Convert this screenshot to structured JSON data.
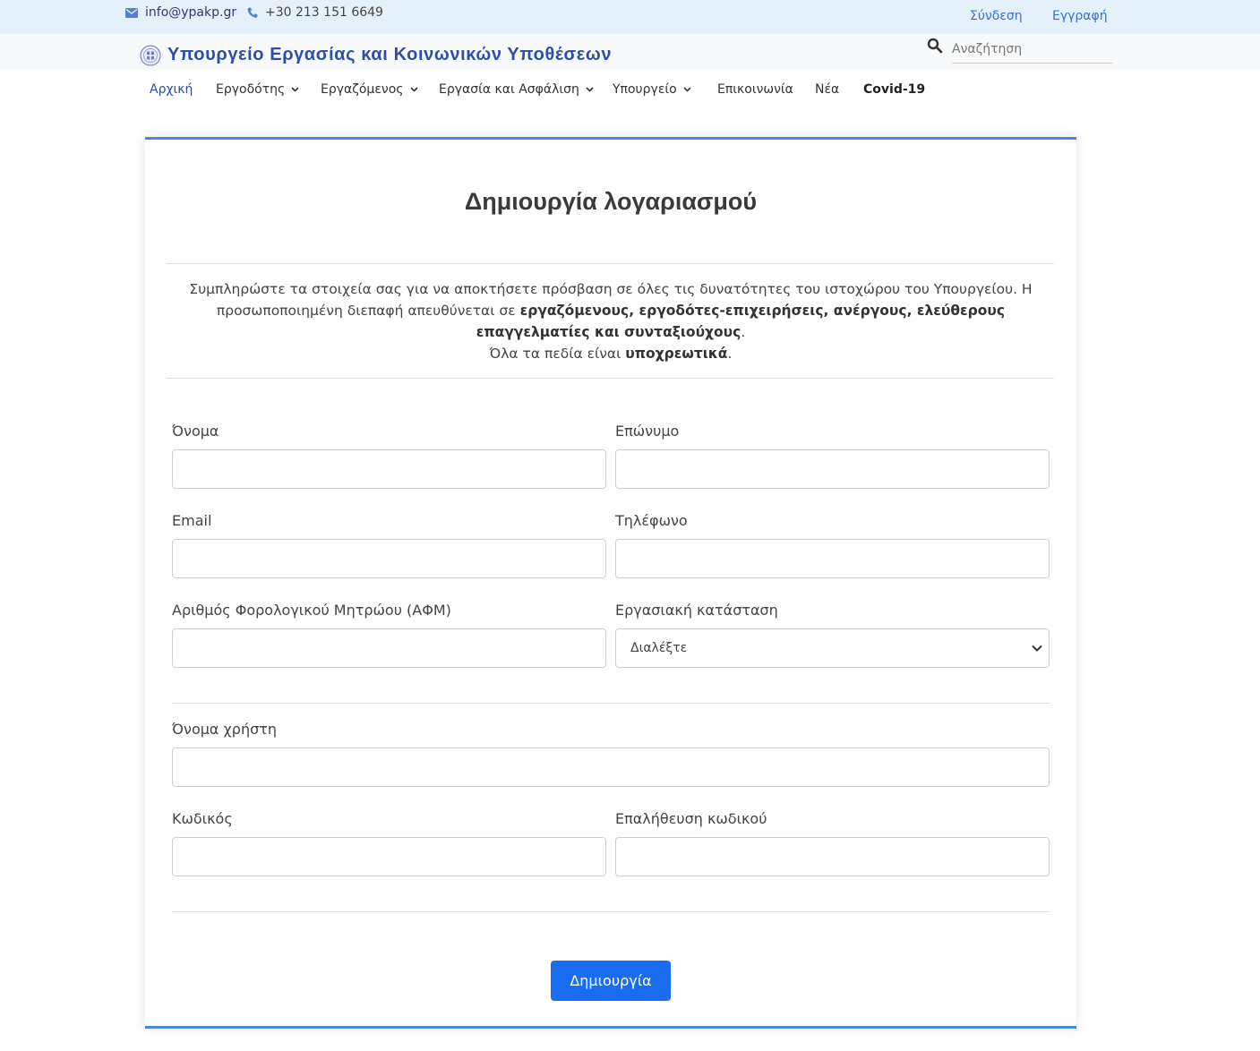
{
  "topbar": {
    "email": "info@ypakp.gr",
    "phone": "+30 213 151 6649",
    "login": "Σύνδεση",
    "register": "Εγγραφή"
  },
  "header": {
    "title": "Υπουργείο Εργασίας και Κοινωνικών Υποθέσεων",
    "search_placeholder": "Αναζήτηση"
  },
  "nav": {
    "items": [
      {
        "label": "Αρχική"
      },
      {
        "label": "Εργοδότης"
      },
      {
        "label": "Εργαζόμενος"
      },
      {
        "label": "Εργασία και Ασφάλιση"
      },
      {
        "label": "Υπουργείο"
      },
      {
        "label": "Επικοινωνία"
      },
      {
        "label": "Νέα"
      },
      {
        "label": "Covid-19"
      }
    ]
  },
  "form": {
    "title": "Δημιουργία λογαριασμού",
    "intro": {
      "p1": "Συμπληρώστε τα στοιχεία σας για να αποκτήσετε πρόσβαση σε όλες τις δυνατότητες του ιστοχώρου του Υπουργείου. Η προσωποποιημένη διεπαφή απευθύνεται σε ",
      "p1_bold": "εργαζόμενους, εργοδότες-επιχειρήσεις, ανέργους, ελεύθερους επαγγελματίες και συνταξιούχους",
      "p1_end": ".",
      "p2": "Όλα τα πεδία είναι ",
      "p2_bold": "υποχρεωτικά",
      "p2_end": "."
    },
    "labels": {
      "first_name": "Όνομα",
      "last_name": "Επώνυμο",
      "email": "Email",
      "phone": "Τηλέφωνο",
      "afm": "Αριθμός Φορολογικού Μητρώου (ΑΦΜ)",
      "employment_status": "Εργασιακή κατάσταση",
      "username": "Όνομα χρήστη",
      "password": "Κωδικός",
      "password_confirm": "Επαλήθευση κωδικού"
    },
    "values": {
      "first_name": "",
      "last_name": "",
      "email": "",
      "phone": "",
      "afm": "",
      "username": "",
      "password": "",
      "password_confirm": ""
    },
    "employment_status_selected": "Διαλέξτε",
    "submit": "Δημιουργία"
  },
  "colors": {
    "topbar_bg": "#e4f0fa",
    "brand_blue": "#2d4fa3",
    "card_border": "#4a86e0",
    "button_bg": "#1a6cf0"
  }
}
